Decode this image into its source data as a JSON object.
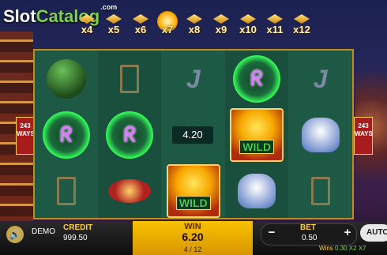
{
  "logo": {
    "slot": "Slot",
    "catalog": "Catalog",
    "com": ".com"
  },
  "multipliers": [
    "x4",
    "x5",
    "x6",
    "x7",
    "x8",
    "x9",
    "x10",
    "x11",
    "x12"
  ],
  "active_multiplier": "x7",
  "ways": {
    "count": "243",
    "label": "WAYS"
  },
  "reels": [
    [
      "frog-icon",
      "scatter",
      "low-q"
    ],
    [
      "low-q",
      "scatter",
      "coin-icon"
    ],
    [
      "low-j",
      "low-k",
      "wild"
    ],
    [
      "scatter",
      "wild",
      "pot-icon"
    ],
    [
      "low-j",
      "pot-icon",
      "low-q"
    ]
  ],
  "symbol_text": {
    "scatter": "ᖇ",
    "wild": "WILD"
  },
  "payout_label": "4.20",
  "bottom_bar": {
    "mode": "DEMO",
    "credit_label": "CREDIT",
    "credit_value": "999.50",
    "win_label": "WIN",
    "win_value": "6.20",
    "page": "4 / 12",
    "bet_label": "BET",
    "bet_value": "0.50",
    "minus": "−",
    "plus": "+",
    "auto": "AUTO",
    "wins_prefix": "Wins",
    "wins_text": "0.30 X2 X7"
  },
  "colors": {
    "frame": "#c48a1c",
    "win_bar": "#f8c200",
    "accent": "#ffcf3a"
  }
}
